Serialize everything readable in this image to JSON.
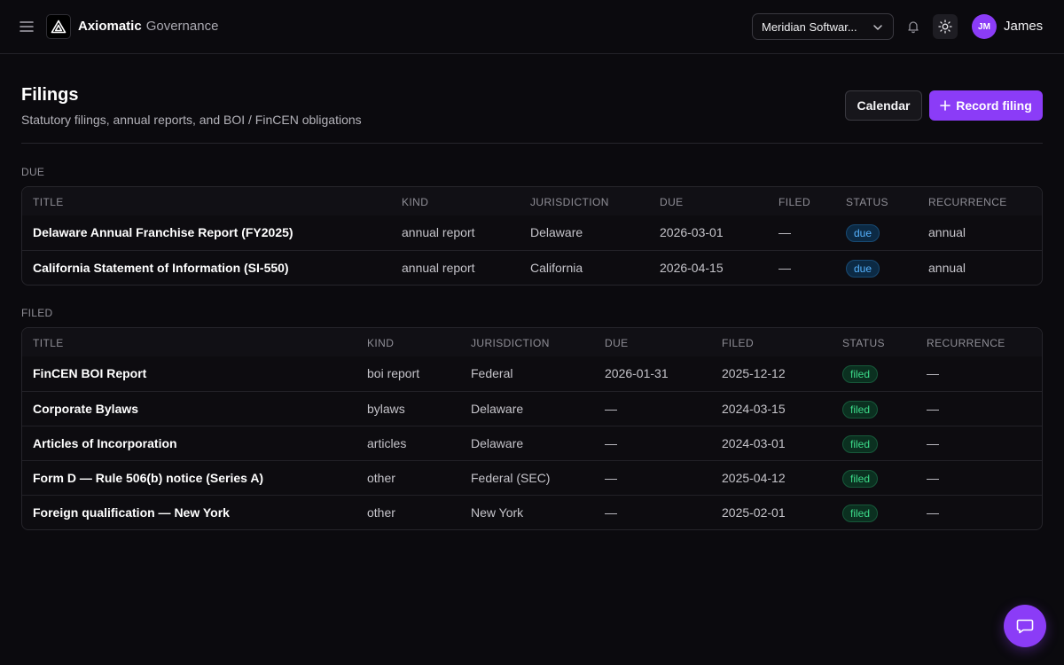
{
  "brand": {
    "name": "Axiomatic",
    "product": "Governance"
  },
  "org_selector": {
    "value": "Meridian Softwar..."
  },
  "user": {
    "initials": "JM",
    "name": "James"
  },
  "page": {
    "title": "Filings",
    "subtitle": "Statutory filings, annual reports, and BOI / FinCEN obligations",
    "calendar_button": "Calendar",
    "record_button": "Record filing"
  },
  "columns": {
    "title": "TITLE",
    "kind": "KIND",
    "jurisdiction": "JURISDICTION",
    "due": "DUE",
    "filed": "FILED",
    "status": "STATUS",
    "recurrence": "RECURRENCE"
  },
  "due_section": {
    "label": "DUE",
    "rows": [
      {
        "title": "Delaware Annual Franchise Report (FY2025)",
        "kind": "annual report",
        "jurisdiction": "Delaware",
        "due": "2026-03-01",
        "filed": "—",
        "status": "due",
        "recurrence": "annual"
      },
      {
        "title": "California Statement of Information (SI-550)",
        "kind": "annual report",
        "jurisdiction": "California",
        "due": "2026-04-15",
        "filed": "—",
        "status": "due",
        "recurrence": "annual"
      }
    ]
  },
  "filed_section": {
    "label": "FILED",
    "rows": [
      {
        "title": "FinCEN BOI Report",
        "kind": "boi report",
        "jurisdiction": "Federal",
        "due": "2026-01-31",
        "filed": "2025-12-12",
        "status": "filed",
        "recurrence": "—"
      },
      {
        "title": "Corporate Bylaws",
        "kind": "bylaws",
        "jurisdiction": "Delaware",
        "due": "—",
        "filed": "2024-03-15",
        "status": "filed",
        "recurrence": "—"
      },
      {
        "title": "Articles of Incorporation",
        "kind": "articles",
        "jurisdiction": "Delaware",
        "due": "—",
        "filed": "2024-03-01",
        "status": "filed",
        "recurrence": "—"
      },
      {
        "title": "Form D — Rule 506(b) notice (Series A)",
        "kind": "other",
        "jurisdiction": "Federal (SEC)",
        "due": "—",
        "filed": "2025-04-12",
        "status": "filed",
        "recurrence": "—"
      },
      {
        "title": "Foreign qualification — New York",
        "kind": "other",
        "jurisdiction": "New York",
        "due": "—",
        "filed": "2025-02-01",
        "status": "filed",
        "recurrence": "—"
      }
    ]
  },
  "icons": {
    "menu": "menu-icon",
    "logo": "axiomatic-logo-icon",
    "chevron": "chevron-down-icon",
    "bell": "bell-icon",
    "theme": "sun-icon",
    "plus": "plus-icon",
    "chat": "chat-icon"
  },
  "colors": {
    "accent": "#8b3cf7",
    "due_badge": "#56b3ff",
    "filed_badge": "#3ddc8a",
    "background": "#0b0a0e"
  }
}
